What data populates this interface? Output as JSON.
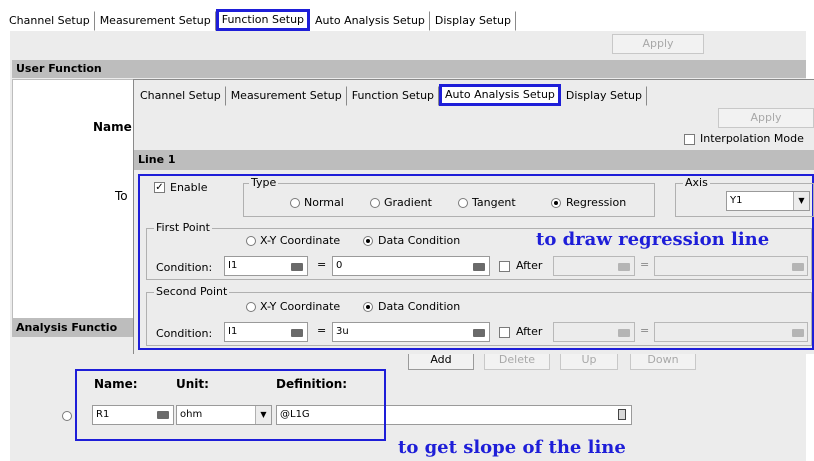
{
  "back": {
    "tabs": [
      "Channel Setup",
      "Measurement Setup",
      "Function Setup",
      "Auto Analysis Setup",
      "Display Setup"
    ],
    "apply_label": "Apply",
    "user_function_header": "User Function",
    "name_label_partial": "Name",
    "to_label_partial": "To",
    "analysis_function_header": "Analysis Functio",
    "buttons": {
      "add": "Add",
      "delete": "Delete",
      "up": "Up",
      "down": "Down"
    },
    "columns": {
      "name": "Name:",
      "unit": "Unit:",
      "definition": "Definition:"
    },
    "row": {
      "name": "R1",
      "unit": "ohm",
      "definition": "@L1G"
    }
  },
  "front": {
    "tabs": [
      "Channel Setup",
      "Measurement Setup",
      "Function Setup",
      "Auto Analysis Setup",
      "Display Setup"
    ],
    "apply_label": "Apply",
    "interpolation_mode": "Interpolation Mode",
    "line_header": "Line 1",
    "enable_label": "Enable",
    "type_title": "Type",
    "type_options": [
      "Normal",
      "Gradient",
      "Tangent",
      "Regression"
    ],
    "axis_title": "Axis",
    "axis_value": "Y1",
    "first_point": {
      "title": "First Point",
      "options": [
        "X-Y Coordinate",
        "Data Condition"
      ],
      "condition_label": "Condition:",
      "var": "I1",
      "eq": "=",
      "value": "0",
      "after_label": "After"
    },
    "second_point": {
      "title": "Second Point",
      "options": [
        "X-Y Coordinate",
        "Data Condition"
      ],
      "condition_label": "Condition:",
      "var": "I1",
      "eq": "=",
      "value": "3u",
      "after_label": "After"
    }
  },
  "annotations": {
    "regression": "to draw regression line",
    "slope": "to get slope of the line"
  },
  "colors": {
    "highlight": "#1e1ed8",
    "panel": "#ececec",
    "header": "#bdbdbd"
  }
}
